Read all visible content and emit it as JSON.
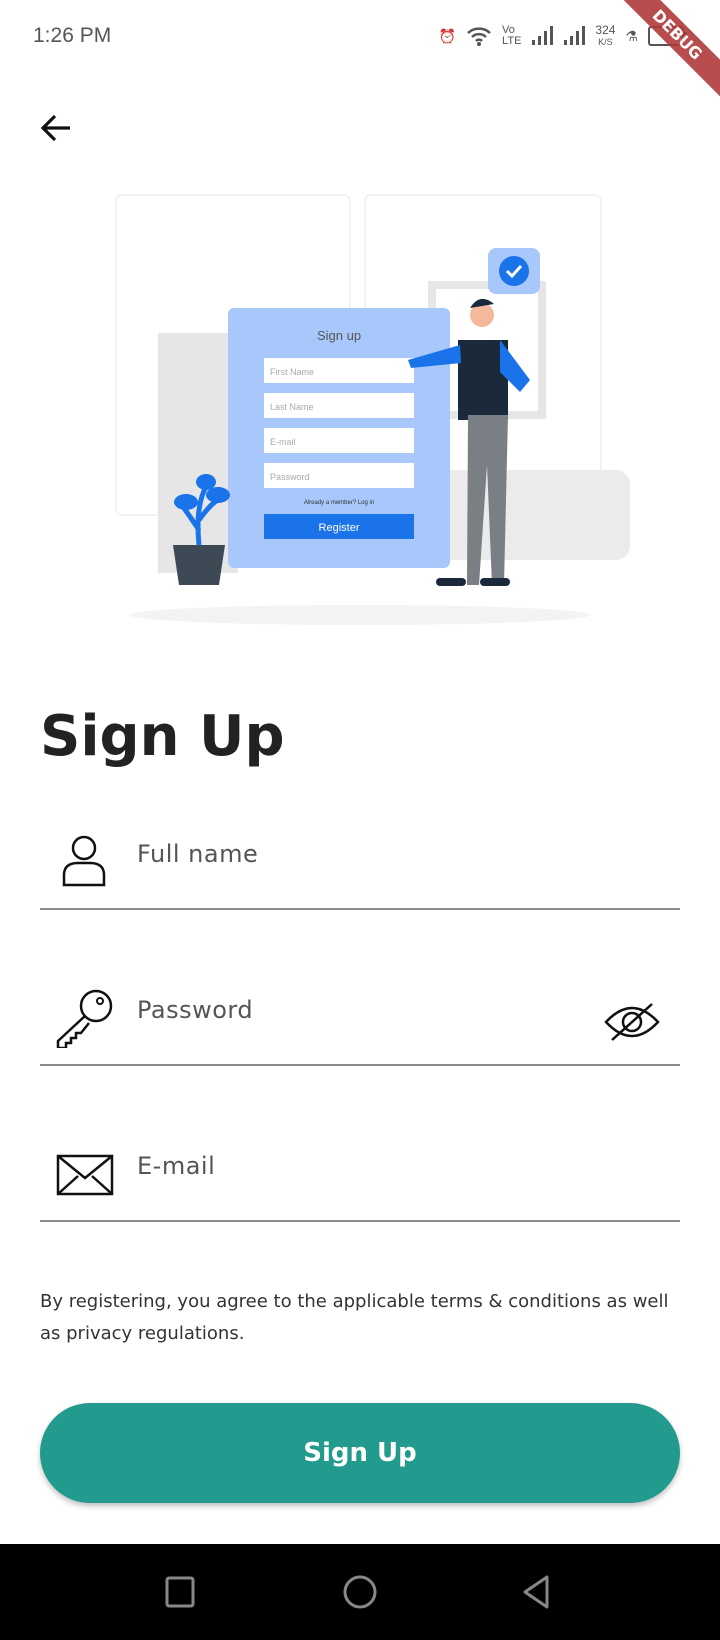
{
  "status_bar": {
    "time": "1:26 PM",
    "net_speed": "324",
    "net_unit": "K/S",
    "volte": "Vo",
    "lte": "LTE",
    "debug_banner": "DEBUG"
  },
  "illustration": {
    "form_title": "Sign up",
    "fields": [
      "First Name",
      "Last Name",
      "E-mail",
      "Password"
    ],
    "login_prompt": "Already a member? Log in",
    "register_label": "Register"
  },
  "page": {
    "title": "Sign Up"
  },
  "form": {
    "full_name_placeholder": "Full name",
    "password_placeholder": "Password",
    "email_placeholder": "E-mail",
    "terms": "By registering, you agree to the applicable terms & conditions as well as privacy regulations.",
    "submit_label": "Sign Up"
  },
  "colors": {
    "accent": "#239a8e",
    "illustration_blue": "#1a73e8"
  }
}
